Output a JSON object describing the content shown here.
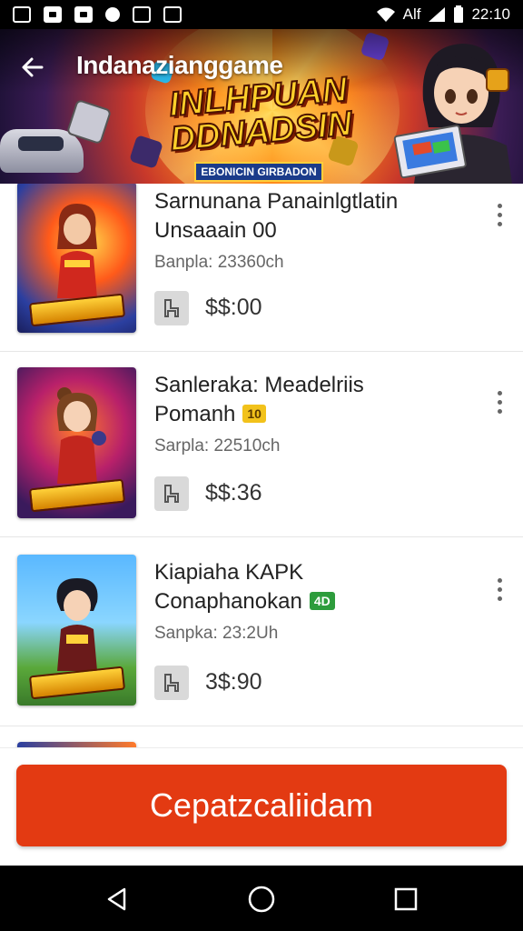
{
  "status_bar": {
    "time": "22:10",
    "network_label": "Alf"
  },
  "header": {
    "title": "Indanazianggame",
    "banner_title": "INLHPUAN DDNADSIN",
    "banner_subtitle": "EBONICIN GIRBADON"
  },
  "items": [
    {
      "title_line1": "Sarnunana Panainlgtlatin",
      "title_line2": "Unsaaain 00",
      "badge": "",
      "meta": "Banpla: 23360ch",
      "price": "$$:00",
      "thumb_logo": "SANDAVAIN"
    },
    {
      "title_line1": "Sanleraka: Meadelriis",
      "title_line2": "Pomanh",
      "badge": "10",
      "badge_color": "#f2c21b",
      "meta": "Sarpla: 22510ch",
      "price": "$$:36",
      "thumb_logo": "BONZAN"
    },
    {
      "title_line1": "Kiapiaha KAPK",
      "title_line2": "Conaphanokan",
      "badge": "4D",
      "badge_color": "#2d9c3c",
      "meta": "Sanpka: 23:2Uh",
      "price": "3$:90",
      "thumb_logo": "DONAIN"
    }
  ],
  "cta": {
    "label": "Cepatzcaliidam"
  },
  "colors": {
    "cta": "#e33a12",
    "status_bar": "#000000"
  }
}
